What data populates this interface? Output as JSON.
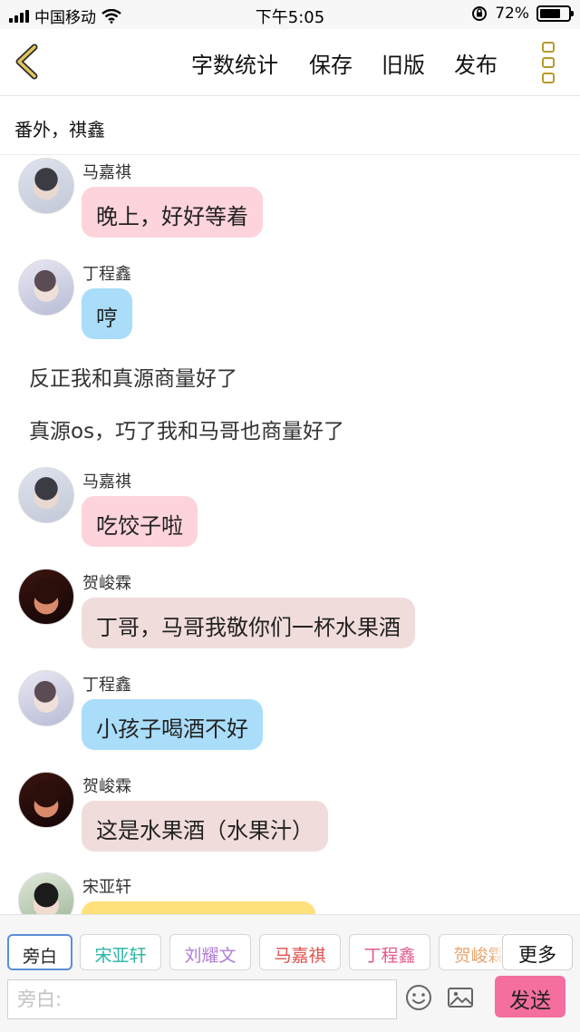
{
  "status_bar": {
    "carrier": "中国移动",
    "time": "下午5:05",
    "battery_text": "72%",
    "battery_level": 0.72
  },
  "toolbar": {
    "back_icon": "chevron-left-icon",
    "word_count": "字数统计",
    "save": "保存",
    "old_version": "旧版",
    "publish": "发布",
    "menu_icon": "more-vertical-icon",
    "accent_color": "#b69a2c"
  },
  "chapter_title": "番外，祺鑫",
  "messages": [
    {
      "speaker": "马嘉祺",
      "text": "晚上，好好等着"
    },
    {
      "speaker": "丁程鑫",
      "text": "哼"
    },
    {
      "narration": "反正我和真源商量好了"
    },
    {
      "narration": "真源os，巧了我和马哥也商量好了"
    },
    {
      "speaker": "马嘉祺",
      "text": "吃饺子啦"
    },
    {
      "speaker": "贺峻霖",
      "text": "丁哥，马哥我敬你们一杯水果酒"
    },
    {
      "speaker": "丁程鑫",
      "text": "小孩子喝酒不好"
    },
    {
      "speaker": "贺峻霖",
      "text": "这是水果酒（水果汁）"
    },
    {
      "speaker": "宋亚轩",
      "text": ""
    }
  ],
  "characters": [
    {
      "label": "旁白",
      "color": "#222222"
    },
    {
      "label": "宋亚轩",
      "color": "#2bb5a3"
    },
    {
      "label": "刘耀文",
      "color": "#b27cd6"
    },
    {
      "label": "马嘉祺",
      "color": "#e2504e"
    },
    {
      "label": "丁程鑫",
      "color": "#e25a8e"
    },
    {
      "label": "贺峻霖",
      "color": "#e8a46e"
    }
  ],
  "more_label": "更多",
  "input": {
    "placeholder": "旁白:",
    "emoji_icon": "smiley-icon",
    "image_icon": "image-icon",
    "send_label": "发送"
  }
}
